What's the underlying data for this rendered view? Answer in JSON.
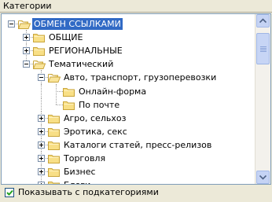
{
  "panel": {
    "title": "Категории"
  },
  "tree": {
    "items": [
      {
        "label": "ОБМЕН ССЫЛКАМИ",
        "level": 0,
        "state": "expanded",
        "selected": true,
        "name": "tree-item-obmen-ssylkami"
      },
      {
        "label": "ОБЩИЕ",
        "level": 1,
        "state": "collapsed",
        "name": "tree-item-obshchie"
      },
      {
        "label": "РЕГИОНАЛЬНЫЕ",
        "level": 1,
        "state": "collapsed",
        "name": "tree-item-regionalnye"
      },
      {
        "label": "Тематический",
        "level": 1,
        "state": "expanded",
        "name": "tree-item-tematicheskiy"
      },
      {
        "label": "Авто, транспорт, грузоперевозки",
        "level": 2,
        "state": "expanded",
        "name": "tree-item-avto"
      },
      {
        "label": "Онлайн-форма",
        "level": 3,
        "state": "leaf",
        "name": "tree-item-onlayn-forma"
      },
      {
        "label": "По почте",
        "level": 3,
        "state": "leaf",
        "name": "tree-item-po-pochte"
      },
      {
        "label": "Агро, сельхоз",
        "level": 2,
        "state": "collapsed",
        "name": "tree-item-agro"
      },
      {
        "label": "Эротика, секс",
        "level": 2,
        "state": "collapsed",
        "name": "tree-item-erotika"
      },
      {
        "label": "Каталоги статей, пресс-релизов",
        "level": 2,
        "state": "collapsed",
        "name": "tree-item-katalogi"
      },
      {
        "label": "Торговля",
        "level": 2,
        "state": "collapsed",
        "name": "tree-item-torgovlya"
      },
      {
        "label": "Бизнес",
        "level": 2,
        "state": "collapsed",
        "name": "tree-item-biznes"
      },
      {
        "label": "Блоги",
        "level": 2,
        "state": "collapsed",
        "name": "tree-item-blogi"
      }
    ]
  },
  "footer": {
    "checkbox_label": "Показывать с подкатегориями",
    "checked": true
  },
  "colors": {
    "selection": "#316ac5",
    "folder": "#f5d671",
    "border": "#7f9db9"
  },
  "icons": {
    "folder": "folder-icon",
    "expander": "expand-collapse-icon",
    "scroll_up": "arrow-up-icon",
    "scroll_down": "arrow-down-icon",
    "check": "checkmark-icon"
  }
}
